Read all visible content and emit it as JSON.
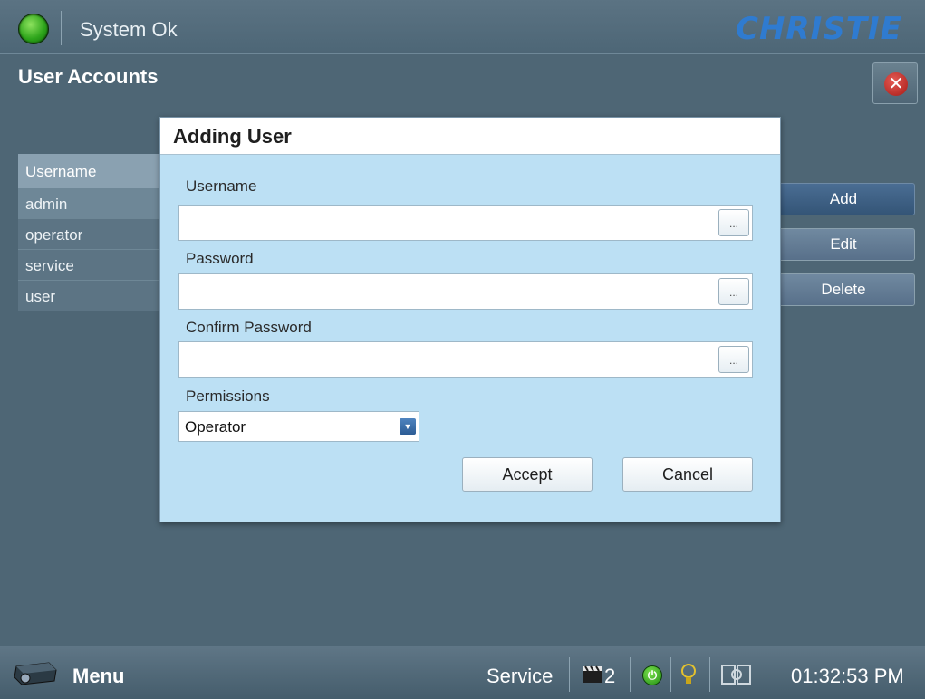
{
  "topbar": {
    "status_text": "System Ok",
    "logo_text": "CHRISTIE",
    "status_color": "#2ea51b",
    "logo_color": "#2f7bd0"
  },
  "page": {
    "title": "User Accounts"
  },
  "user_list": {
    "header": "Username",
    "rows": [
      "admin",
      "operator",
      "service",
      "user"
    ],
    "selected_index": 0
  },
  "actions": {
    "add": "Add",
    "edit": "Edit",
    "delete": "Delete"
  },
  "modal": {
    "title": "Adding User",
    "username_label": "Username",
    "username_value": "",
    "password_label": "Password",
    "password_value": "",
    "confirm_label": "Confirm Password",
    "confirm_value": "",
    "ellipsis": "...",
    "permissions_label": "Permissions",
    "permissions_value": "Operator",
    "accept": "Accept",
    "cancel": "Cancel"
  },
  "bottombar": {
    "menu_label": "Menu",
    "service_label": "Service",
    "channel": "2",
    "clock": "01:32:53 PM"
  },
  "icons": {
    "status": "status-led-icon",
    "close": "close-icon",
    "projector": "projector-icon",
    "clapper": "clapperboard-icon",
    "power": "power-icon",
    "bulb": "lamp-icon",
    "tools": "tools-icon",
    "dropdown": "chevron-down-icon"
  }
}
